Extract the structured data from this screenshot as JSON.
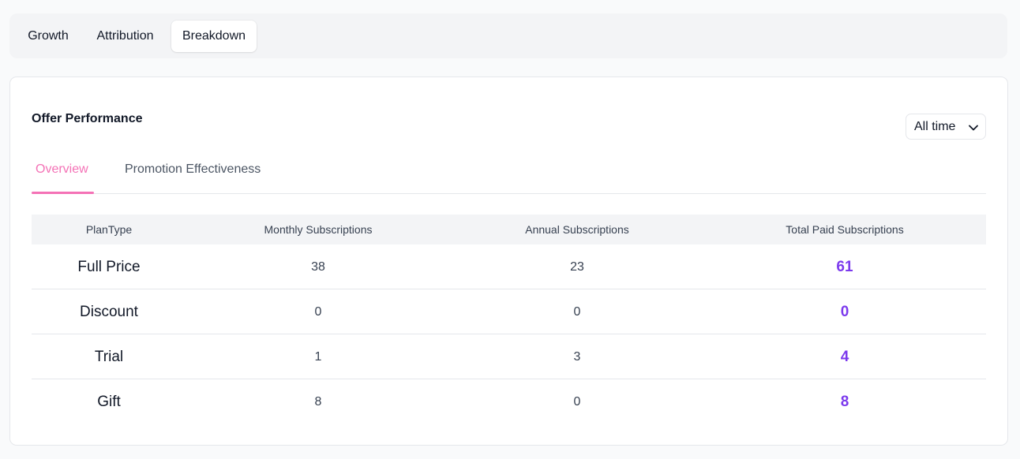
{
  "top_tabs": [
    {
      "label": "Growth",
      "active": false
    },
    {
      "label": "Attribution",
      "active": false
    },
    {
      "label": "Breakdown",
      "active": true
    }
  ],
  "card": {
    "title": "Offer Performance",
    "range_select": {
      "value": "All time",
      "icon": "chevron-down-icon"
    }
  },
  "sub_tabs": [
    {
      "label": "Overview",
      "active": true
    },
    {
      "label": "Promotion Effectiveness",
      "active": false
    }
  ],
  "colors": {
    "accent_pink": "#f472b6",
    "total_purple": "#7c3aed"
  },
  "table": {
    "headers": [
      "PlanType",
      "Monthly Subscriptions",
      "Annual Subscriptions",
      "Total Paid Subscriptions"
    ],
    "rows": [
      {
        "plan": "Full Price",
        "monthly": "38",
        "annual": "23",
        "total": "61"
      },
      {
        "plan": "Discount",
        "monthly": "0",
        "annual": "0",
        "total": "0"
      },
      {
        "plan": "Trial",
        "monthly": "1",
        "annual": "3",
        "total": "4"
      },
      {
        "plan": "Gift",
        "monthly": "8",
        "annual": "0",
        "total": "8"
      }
    ]
  }
}
